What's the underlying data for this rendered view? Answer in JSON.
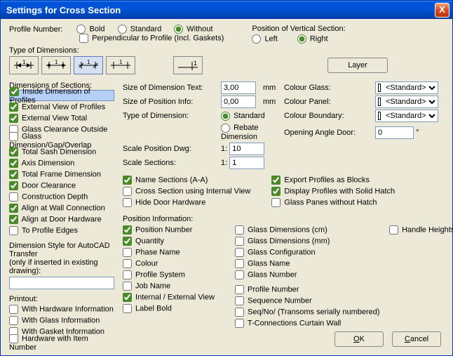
{
  "window": {
    "title": "Settings for Cross Section",
    "close": "X"
  },
  "profileNumber": {
    "label": "Profile Number:",
    "bold": "Bold",
    "standard": "Standard",
    "without": "Without",
    "perp": "Perpendicular to Profile (Incl. Gaskets)"
  },
  "vertSection": {
    "label": "Position of Vertical Section:",
    "left": "Left",
    "right": "Right"
  },
  "typeDim": {
    "label": "Type of Dimensions:"
  },
  "layerBtn": "Layer",
  "dimSections": {
    "label": "Dimensions of Sections:",
    "items": [
      {
        "label": "Inside Dimension of Profiles",
        "checked": true,
        "hl": true
      },
      {
        "label": "External View of Profiles",
        "checked": true
      },
      {
        "label": "External View Total",
        "checked": true
      },
      {
        "label": "Glass Clearance Outside",
        "checked": false
      },
      {
        "label": "Glass Dimension/Gap/Overlap",
        "checked": false
      },
      {
        "label": "Total Sash Dimension",
        "checked": true
      },
      {
        "label": "Axis Dimension",
        "checked": true
      },
      {
        "label": "Total Frame Dimension",
        "checked": true
      },
      {
        "label": "Door Clearance",
        "checked": true
      },
      {
        "label": "Construction Depth",
        "checked": false
      },
      {
        "label": "Align at Wall Connection",
        "checked": true
      },
      {
        "label": "Align at Door Hardware",
        "checked": true
      },
      {
        "label": "To Profile Edges",
        "checked": false
      }
    ]
  },
  "dimStyle": {
    "label1": "Dimension Style for AutoCAD Transfer",
    "label2": "(only if inserted in existing drawing):",
    "val": ""
  },
  "printout": {
    "label": "Printout:",
    "items": [
      {
        "label": "With Hardware Information",
        "checked": false
      },
      {
        "label": "With Glass Information",
        "checked": false
      },
      {
        "label": "With Gasket Information",
        "checked": false
      },
      {
        "label": "Hardware with Item Number",
        "checked": false
      }
    ]
  },
  "mid": {
    "sizeDimText": {
      "label": "Size of Dimension Text:",
      "val": "3,00",
      "unit": "mm"
    },
    "sizePosInfo": {
      "label": "Size of Position Info:",
      "val": "0,00",
      "unit": "mm"
    },
    "typeOfDim": {
      "label": "Type of Dimension:",
      "std": "Standard",
      "reb": "Rebate Dimension"
    },
    "scalePosDwg": {
      "label": "Scale Position Dwg:",
      "one": "1:",
      "val": "10"
    },
    "scaleSections": {
      "label": "Scale Sections:",
      "one": "1:",
      "val": "1"
    }
  },
  "right": {
    "colourGlass": {
      "label": "Colour Glass:",
      "val": "<Standard>"
    },
    "colourPanel": {
      "label": "Colour Panel:",
      "val": "<Standard>"
    },
    "colourBoundary": {
      "label": "Colour Boundary:",
      "val": "<Standard>"
    },
    "openAngle": {
      "label": "Opening Angle Door:",
      "val": "0",
      "unit": "°"
    }
  },
  "midChecksLeft": [
    {
      "label": "Name Sections (A-A)",
      "checked": true
    },
    {
      "label": "Cross Section using Internal View",
      "checked": false
    },
    {
      "label": "Hide Door Hardware",
      "checked": false
    }
  ],
  "midChecksRight": [
    {
      "label": "Export Profiles as Blocks",
      "checked": true
    },
    {
      "label": "Display Profiles with Solid Hatch",
      "checked": true
    },
    {
      "label": "Glass Panes without Hatch",
      "checked": false
    }
  ],
  "posInfo": {
    "label": "Position Information:",
    "col1": [
      {
        "label": "Position Number",
        "checked": true
      },
      {
        "label": "Quantity",
        "checked": true
      },
      {
        "label": "Phase Name",
        "checked": false
      },
      {
        "label": "Colour",
        "checked": false
      },
      {
        "label": "Profile System",
        "checked": false
      },
      {
        "label": "Job Name",
        "checked": false
      },
      {
        "label": "Internal / External View",
        "checked": true
      },
      {
        "label": "Label Bold",
        "checked": false
      }
    ],
    "col2": [
      {
        "label": "Glass Dimensions (cm)",
        "checked": false
      },
      {
        "label": "Glass Dimensions (mm)",
        "checked": false
      },
      {
        "label": "Glass Configuration",
        "checked": false
      },
      {
        "label": "Glass Name",
        "checked": false
      },
      {
        "label": "Glass Number",
        "checked": false
      }
    ],
    "col2b": [
      {
        "label": "Profile Number",
        "checked": false
      },
      {
        "label": "Sequence Number",
        "checked": false
      },
      {
        "label": "Seq/No/ (Transoms serially numbered)",
        "checked": false
      },
      {
        "label": "T-Connections Curtain Wall",
        "checked": false
      }
    ],
    "handle": {
      "label": "Handle Heights",
      "checked": false
    }
  },
  "buttons": {
    "ok": "OK",
    "cancel": "Cancel"
  }
}
